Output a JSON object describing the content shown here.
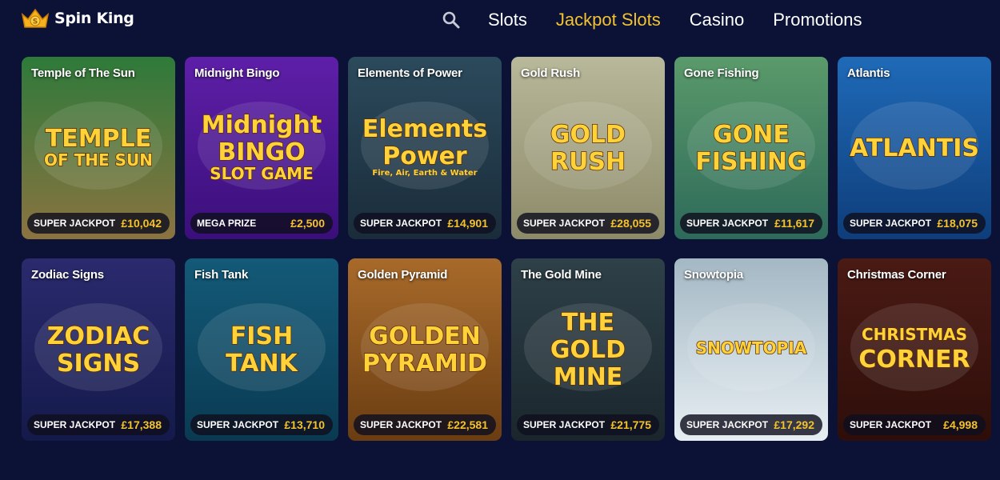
{
  "brand": {
    "name": "Spin King"
  },
  "nav": {
    "items": [
      {
        "label": "Slots",
        "active": false
      },
      {
        "label": "Jackpot Slots",
        "active": true
      },
      {
        "label": "Casino",
        "active": false
      },
      {
        "label": "Promotions",
        "active": false
      }
    ]
  },
  "colors": {
    "background": "#0b1236",
    "accent": "#f2c230",
    "jackpot_amount": "#f5c22c"
  },
  "games": [
    {
      "title": "Temple of The Sun",
      "art_lines": [
        "TEMPLE",
        "OF THE SUN"
      ],
      "jackpot_label": "SUPER JACKPOT",
      "jackpot_amount": "£10,042",
      "bg": [
        "#2e7a3a",
        "#8b7340"
      ]
    },
    {
      "title": "Midnight Bingo",
      "art_lines": [
        "Midnight",
        "BINGO",
        "SLOT GAME"
      ],
      "jackpot_label": "MEGA PRIZE",
      "jackpot_amount": "£2,500",
      "bg": [
        "#5e1fa8",
        "#3a0f7a"
      ]
    },
    {
      "title": "Elements of Power",
      "art_lines": [
        "Elements",
        "Power",
        "Fire, Air, Earth & Water"
      ],
      "jackpot_label": "SUPER JACKPOT",
      "jackpot_amount": "£14,901",
      "bg": [
        "#2b4a5c",
        "#1a2c3a"
      ]
    },
    {
      "title": "Gold Rush",
      "art_lines": [
        "GOLD",
        "RUSH"
      ],
      "jackpot_label": "SUPER JACKPOT",
      "jackpot_amount": "£28,055",
      "bg": [
        "#b8b89a",
        "#8c8a68"
      ]
    },
    {
      "title": "Gone Fishing",
      "art_lines": [
        "GONE",
        "FISHING"
      ],
      "jackpot_label": "SUPER JACKPOT",
      "jackpot_amount": "£11,617",
      "bg": [
        "#5a9a6a",
        "#2e6a5a"
      ]
    },
    {
      "title": "Atlantis",
      "art_lines": [
        "ATLANTIS"
      ],
      "jackpot_label": "SUPER JACKPOT",
      "jackpot_amount": "£18,075",
      "bg": [
        "#1f6ab8",
        "#0e3d7a"
      ]
    },
    {
      "title": "Zodiac Signs",
      "art_lines": [
        "ZODIAC",
        "SIGNS"
      ],
      "jackpot_label": "SUPER JACKPOT",
      "jackpot_amount": "£17,388",
      "bg": [
        "#2a2a6e",
        "#141a4a"
      ]
    },
    {
      "title": "Fish Tank",
      "art_lines": [
        "FISH",
        "TANK"
      ],
      "jackpot_label": "SUPER JACKPOT",
      "jackpot_amount": "£13,710",
      "bg": [
        "#135a78",
        "#0a3a52"
      ]
    },
    {
      "title": "Golden Pyramid",
      "art_lines": [
        "GOLDEN",
        "PYRAMID"
      ],
      "jackpot_label": "SUPER JACKPOT",
      "jackpot_amount": "£22,581",
      "bg": [
        "#a86a2a",
        "#6a3d12"
      ]
    },
    {
      "title": "The Gold Mine",
      "art_lines": [
        "THE",
        "GOLD",
        "MINE"
      ],
      "jackpot_label": "SUPER JACKPOT",
      "jackpot_amount": "£21,775",
      "bg": [
        "#2e4048",
        "#1a262c"
      ]
    },
    {
      "title": "Snowtopia",
      "art_lines": [
        "SNOWTOPIA"
      ],
      "jackpot_label": "SUPER JACKPOT",
      "jackpot_amount": "£17,292",
      "bg": [
        "#a4b8c4",
        "#e6eef2"
      ]
    },
    {
      "title": "Christmas Corner",
      "art_lines": [
        "CHRISTMAS",
        "CORNER"
      ],
      "jackpot_label": "SUPER JACKPOT",
      "jackpot_amount": "£4,998",
      "bg": [
        "#4a1a14",
        "#2e0e0a"
      ]
    }
  ]
}
